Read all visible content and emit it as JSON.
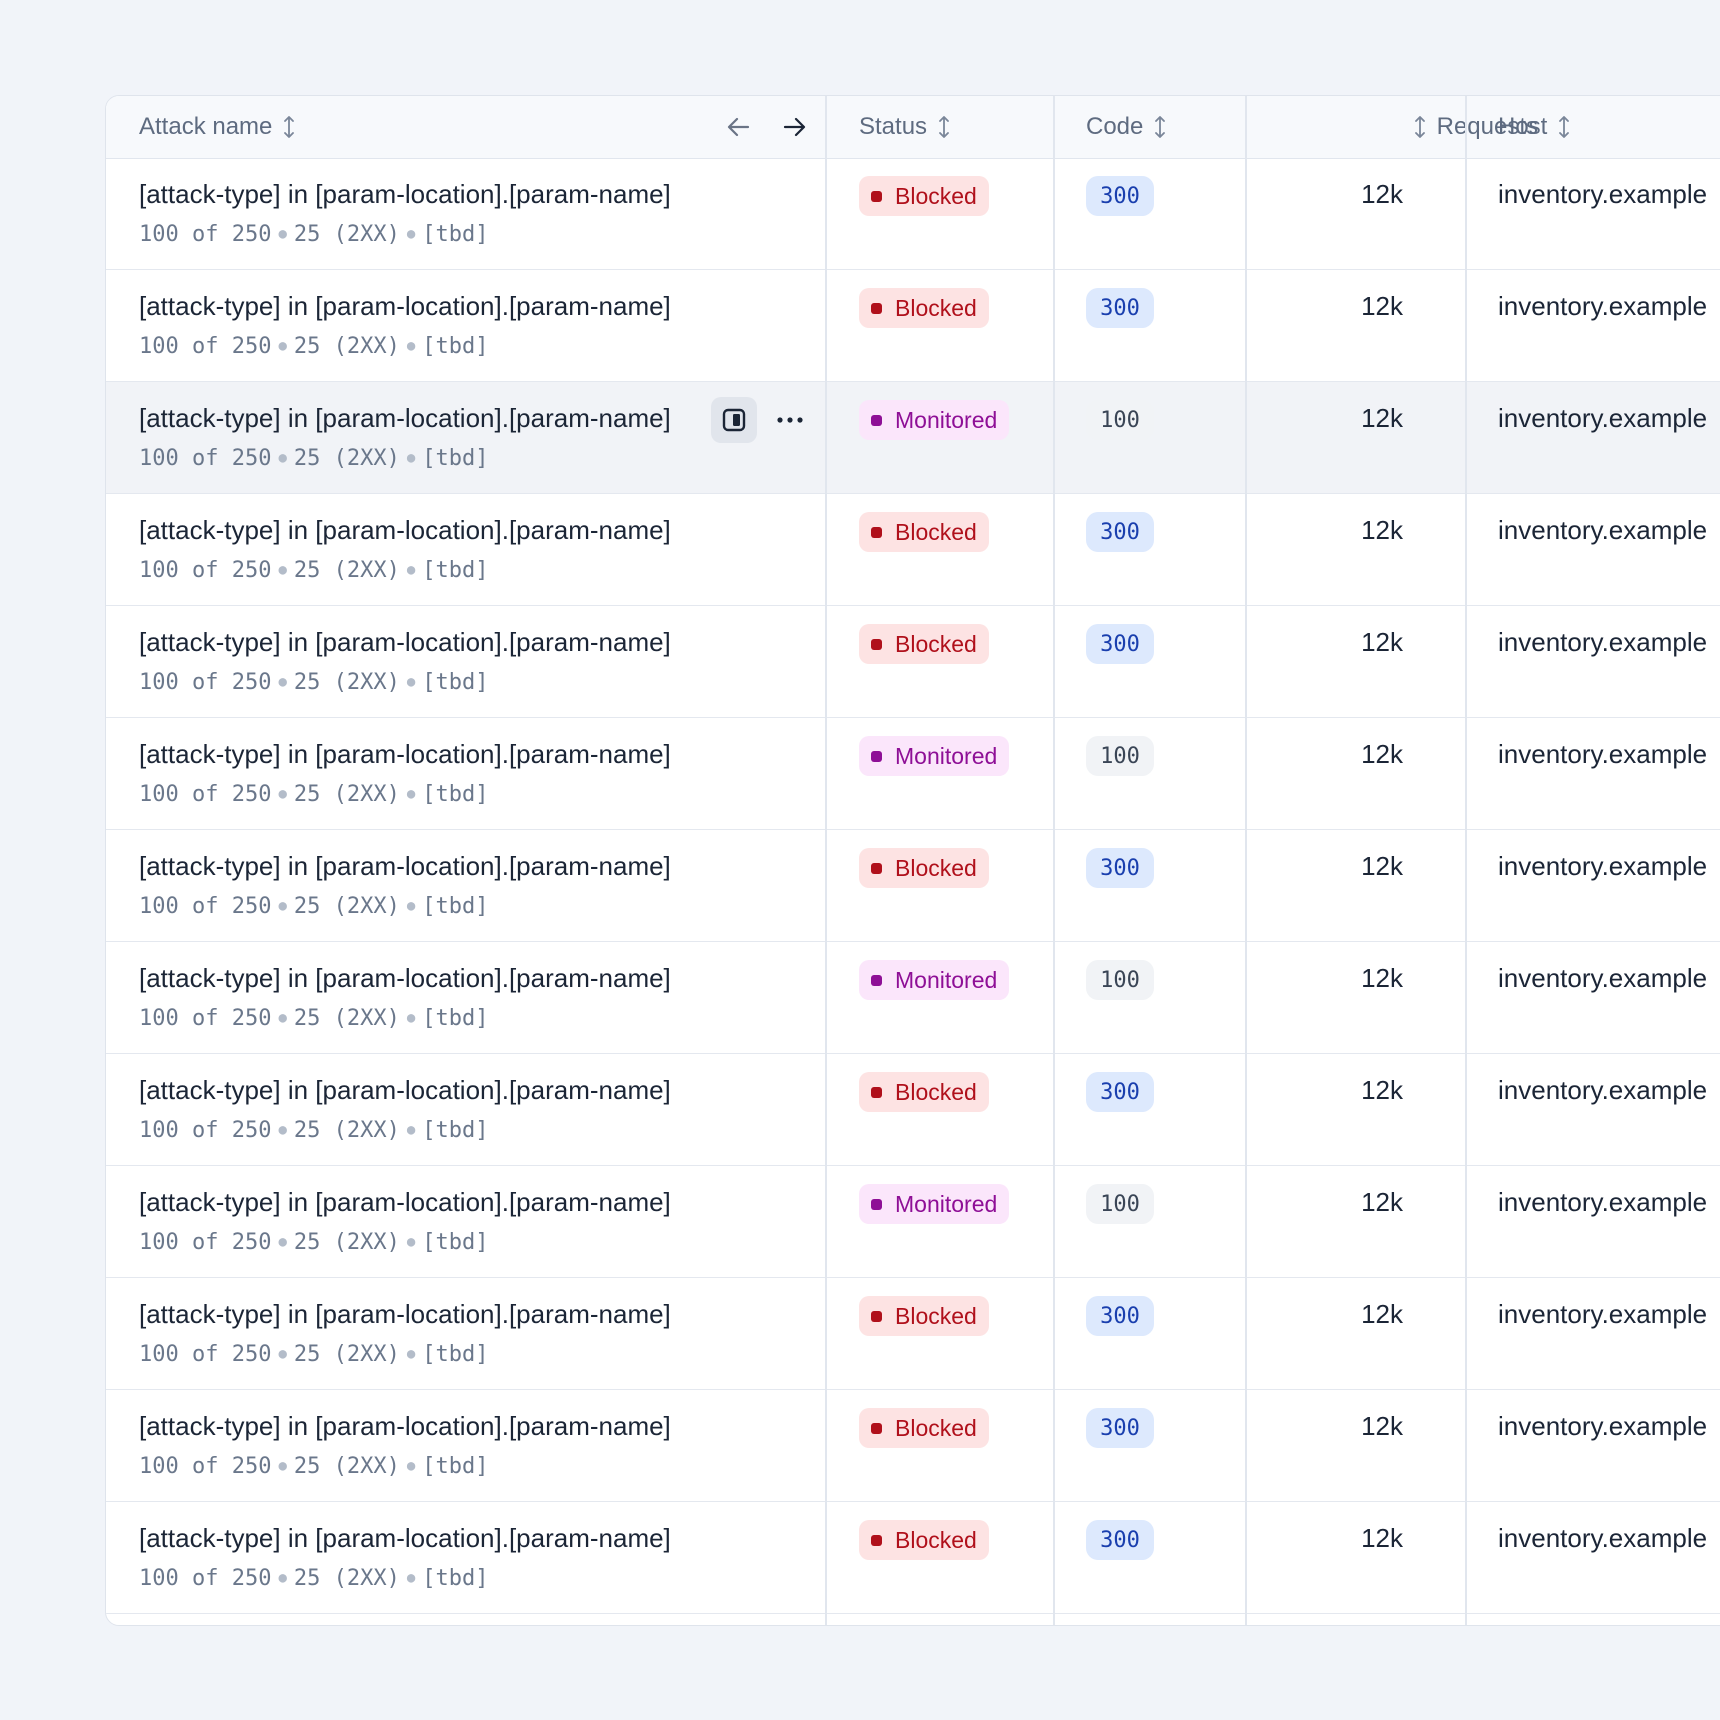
{
  "table": {
    "columns": {
      "attack_name": "Attack name",
      "status": "Status",
      "code": "Code",
      "requests": "Requests",
      "host": "Host"
    },
    "rows": [
      {
        "title": "[attack-type] in [param-location].[param-name]",
        "meta_a": "100 of 250",
        "meta_b": "25 (2XX)",
        "meta_c": "[tbd]",
        "status": "Blocked",
        "status_kind": "blocked",
        "code": "300",
        "requests": "12k",
        "host": "inventory.example"
      },
      {
        "title": "[attack-type] in [param-location].[param-name]",
        "meta_a": "100 of 250",
        "meta_b": "25 (2XX)",
        "meta_c": "[tbd]",
        "status": "Blocked",
        "status_kind": "blocked",
        "code": "300",
        "requests": "12k",
        "host": "inventory.example"
      },
      {
        "title": "[attack-type] in [param-location].[param-name]",
        "meta_a": "100 of 250",
        "meta_b": "25 (2XX)",
        "meta_c": "[tbd]",
        "status": "Monitored",
        "status_kind": "monitored",
        "code": "100",
        "requests": "12k",
        "host": "inventory.example",
        "hovered": true
      },
      {
        "title": "[attack-type] in [param-location].[param-name]",
        "meta_a": "100 of 250",
        "meta_b": "25 (2XX)",
        "meta_c": "[tbd]",
        "status": "Blocked",
        "status_kind": "blocked",
        "code": "300",
        "requests": "12k",
        "host": "inventory.example"
      },
      {
        "title": "[attack-type] in [param-location].[param-name]",
        "meta_a": "100 of 250",
        "meta_b": "25 (2XX)",
        "meta_c": "[tbd]",
        "status": "Blocked",
        "status_kind": "blocked",
        "code": "300",
        "requests": "12k",
        "host": "inventory.example"
      },
      {
        "title": "[attack-type] in [param-location].[param-name]",
        "meta_a": "100 of 250",
        "meta_b": "25 (2XX)",
        "meta_c": "[tbd]",
        "status": "Monitored",
        "status_kind": "monitored",
        "code": "100",
        "requests": "12k",
        "host": "inventory.example"
      },
      {
        "title": "[attack-type] in [param-location].[param-name]",
        "meta_a": "100 of 250",
        "meta_b": "25 (2XX)",
        "meta_c": "[tbd]",
        "status": "Blocked",
        "status_kind": "blocked",
        "code": "300",
        "requests": "12k",
        "host": "inventory.example"
      },
      {
        "title": "[attack-type] in [param-location].[param-name]",
        "meta_a": "100 of 250",
        "meta_b": "25 (2XX)",
        "meta_c": "[tbd]",
        "status": "Monitored",
        "status_kind": "monitored",
        "code": "100",
        "requests": "12k",
        "host": "inventory.example"
      },
      {
        "title": "[attack-type] in [param-location].[param-name]",
        "meta_a": "100 of 250",
        "meta_b": "25 (2XX)",
        "meta_c": "[tbd]",
        "status": "Blocked",
        "status_kind": "blocked",
        "code": "300",
        "requests": "12k",
        "host": "inventory.example"
      },
      {
        "title": "[attack-type] in [param-location].[param-name]",
        "meta_a": "100 of 250",
        "meta_b": "25 (2XX)",
        "meta_c": "[tbd]",
        "status": "Monitored",
        "status_kind": "monitored",
        "code": "100",
        "requests": "12k",
        "host": "inventory.example"
      },
      {
        "title": "[attack-type] in [param-location].[param-name]",
        "meta_a": "100 of 250",
        "meta_b": "25 (2XX)",
        "meta_c": "[tbd]",
        "status": "Blocked",
        "status_kind": "blocked",
        "code": "300",
        "requests": "12k",
        "host": "inventory.example"
      },
      {
        "title": "[attack-type] in [param-location].[param-name]",
        "meta_a": "100 of 250",
        "meta_b": "25 (2XX)",
        "meta_c": "[tbd]",
        "status": "Blocked",
        "status_kind": "blocked",
        "code": "300",
        "requests": "12k",
        "host": "inventory.example"
      },
      {
        "title": "[attack-type] in [param-location].[param-name]",
        "meta_a": "100 of 250",
        "meta_b": "25 (2XX)",
        "meta_c": "[tbd]",
        "status": "Blocked",
        "status_kind": "blocked",
        "code": "300",
        "requests": "12k",
        "host": "inventory.example"
      }
    ]
  },
  "icons": {
    "sort": "sort-arrows-icon",
    "scroll_left": "arrow-left-icon",
    "scroll_right": "arrow-right-icon",
    "panel": "side-panel-icon",
    "more": "more-horizontal-icon"
  },
  "colors": {
    "blocked_bg": "#fde3e3",
    "blocked_fg": "#b0101b",
    "monitored_bg": "#fbe6fb",
    "monitored_fg": "#8e0f96",
    "code300_bg": "#dde9fd",
    "code300_fg": "#1a3fae"
  }
}
